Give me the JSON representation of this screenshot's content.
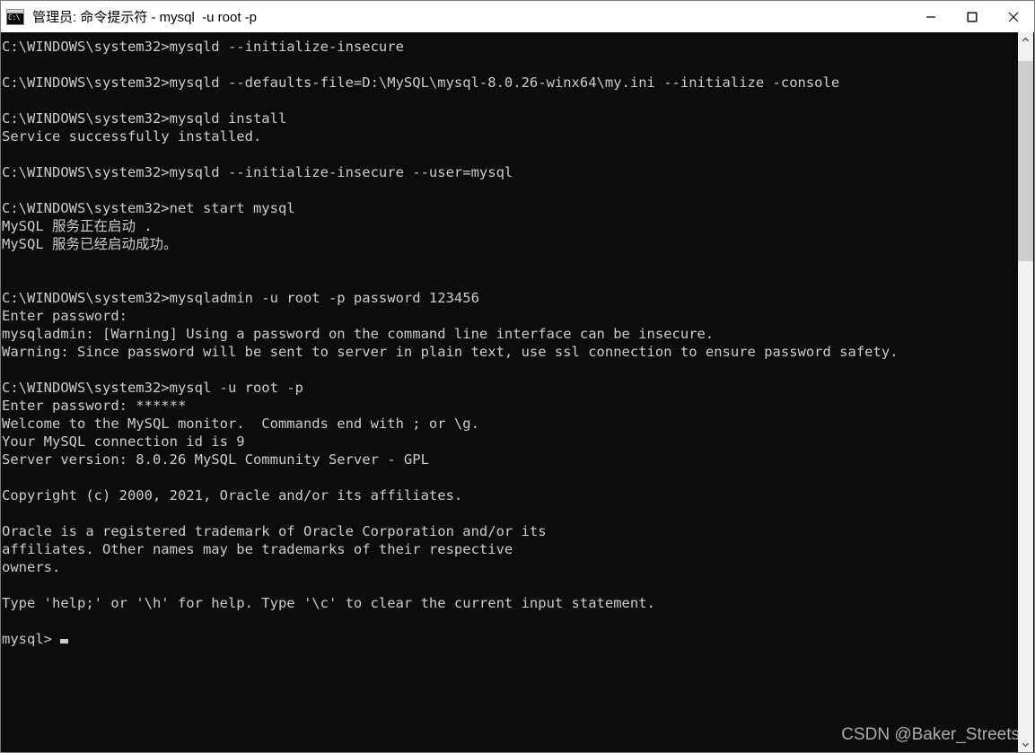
{
  "window": {
    "title": "管理员: 命令提示符 - mysql  -u root -p",
    "icon_name": "cmd-icon",
    "icon_text": "C:\\",
    "controls": {
      "minimize_label": "Minimize",
      "maximize_label": "Maximize",
      "close_label": "Close"
    },
    "colors": {
      "titlebar_bg": "#ffffff",
      "titlebar_fg": "#000000",
      "console_bg": "#0c0c0c",
      "console_fg": "#cccccc",
      "scrollbar_track": "#f0f0f0",
      "scrollbar_thumb": "#cdcdcd"
    }
  },
  "terminal": {
    "prompt": "C:\\WINDOWS\\system32>",
    "lines": [
      "C:\\WINDOWS\\system32>mysqld --initialize-insecure",
      "",
      "C:\\WINDOWS\\system32>mysqld --defaults-file=D:\\MySQL\\mysql-8.0.26-winx64\\my.ini --initialize -console",
      "",
      "C:\\WINDOWS\\system32>mysqld install",
      "Service successfully installed.",
      "",
      "C:\\WINDOWS\\system32>mysqld --initialize-insecure --user=mysql",
      "",
      "C:\\WINDOWS\\system32>net start mysql",
      "MySQL 服务正在启动 .",
      "MySQL 服务已经启动成功。",
      "",
      "",
      "C:\\WINDOWS\\system32>mysqladmin -u root -p password 123456",
      "Enter password:",
      "mysqladmin: [Warning] Using a password on the command line interface can be insecure.",
      "Warning: Since password will be sent to server in plain text, use ssl connection to ensure password safety.",
      "",
      "C:\\WINDOWS\\system32>mysql -u root -p",
      "Enter password: ******",
      "Welcome to the MySQL monitor.  Commands end with ; or \\g.",
      "Your MySQL connection id is 9",
      "Server version: 8.0.26 MySQL Community Server - GPL",
      "",
      "Copyright (c) 2000, 2021, Oracle and/or its affiliates.",
      "",
      "Oracle is a registered trademark of Oracle Corporation and/or its",
      "affiliates. Other names may be trademarks of their respective",
      "owners.",
      "",
      "Type 'help;' or '\\h' for help. Type '\\c' to clear the current input statement.",
      ""
    ],
    "final_prompt": "mysql> ",
    "cursor_visible": true
  },
  "watermark": {
    "text": "CSDN @Baker_Streets"
  },
  "scrollbar": {
    "up_arrow": "scroll-up",
    "down_arrow": "scroll-down",
    "thumb_position_pct": 2,
    "thumb_size_pct": 29
  }
}
